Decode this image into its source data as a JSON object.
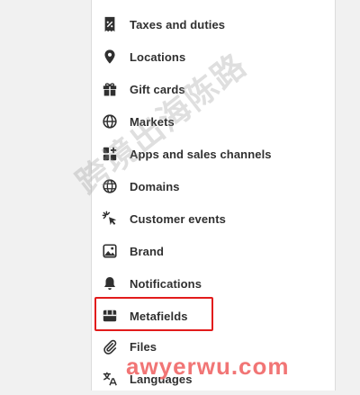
{
  "settings_nav": {
    "items": [
      {
        "label": "Taxes and duties",
        "icon": "receipt-percent-icon"
      },
      {
        "label": "Locations",
        "icon": "location-pin-icon"
      },
      {
        "label": "Gift cards",
        "icon": "gift-icon"
      },
      {
        "label": "Markets",
        "icon": "globe-icon"
      },
      {
        "label": "Apps and sales channels",
        "icon": "apps-icon"
      },
      {
        "label": "Domains",
        "icon": "domain-globe-icon"
      },
      {
        "label": "Customer events",
        "icon": "cursor-click-icon"
      },
      {
        "label": "Brand",
        "icon": "image-icon"
      },
      {
        "label": "Notifications",
        "icon": "bell-icon"
      },
      {
        "label": "Metafields",
        "icon": "metafields-icon"
      },
      {
        "label": "Files",
        "icon": "paperclip-icon"
      },
      {
        "label": "Languages",
        "icon": "translate-icon"
      }
    ]
  },
  "highlight": {
    "target": "Metafields",
    "color": "#e21b1b"
  },
  "watermarks": {
    "diagonal_text": "跨境出海陈路",
    "site_text": "awyerwu.com",
    "site_color": "#f06a6a"
  },
  "colors": {
    "panel_background": "#ffffff",
    "page_background": "#f1f1f1",
    "text": "#303030"
  }
}
